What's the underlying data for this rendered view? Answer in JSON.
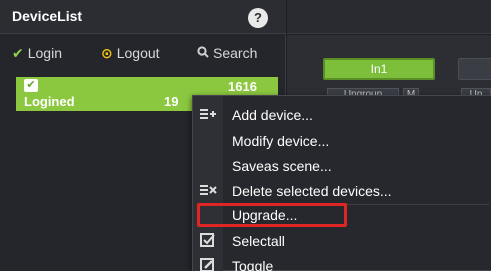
{
  "panel": {
    "title": "DeviceList",
    "help_icon": "?"
  },
  "toolbar": {
    "login_icon": "✔",
    "login": "Login",
    "logout_icon": "⊙",
    "logout": "Logout",
    "search_icon": "🔍",
    "search": "Search"
  },
  "device": {
    "check": "✔",
    "status": "Logined",
    "id": "1616",
    "ip": "19"
  },
  "right": {
    "in_button": "In1",
    "mini_buttons": [
      "Ungroup",
      "M",
      "Un"
    ]
  },
  "context_menu": {
    "items": [
      {
        "label": "Add device...",
        "icon": "add-device-icon"
      },
      {
        "label": "Modify device...",
        "icon": ""
      },
      {
        "label": "Saveas scene...",
        "icon": ""
      },
      {
        "label": "Delete selected devices...",
        "icon": "delete-devices-icon"
      },
      {
        "label": "Upgrade...",
        "icon": ""
      },
      {
        "label": "Selectall",
        "icon": "selectall-icon"
      },
      {
        "label": "Toggle",
        "icon": "toggle-icon"
      }
    ]
  },
  "colors": {
    "accent_green": "#8cc83f",
    "highlight_red": "#e02525"
  }
}
